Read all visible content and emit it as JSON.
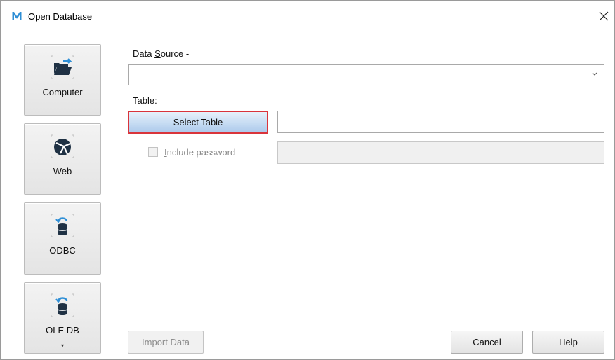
{
  "window": {
    "title": "Open Database",
    "logo_letter": "M",
    "logo_color": "#2f8fd6"
  },
  "sidebar": {
    "items": [
      {
        "label": "Computer",
        "icon": "folder-open-icon"
      },
      {
        "label": "Web",
        "icon": "globe-icon"
      },
      {
        "label": "ODBC",
        "icon": "database-refresh-icon"
      },
      {
        "label": "OLE DB",
        "icon": "database-refresh-icon",
        "dropdown": "▾"
      }
    ]
  },
  "form": {
    "data_source": {
      "label_prefix": "Data ",
      "label_accel": "S",
      "label_suffix": "ource -",
      "value": ""
    },
    "table": {
      "label": "Table:",
      "select_button_label": "Select Table",
      "value": ""
    },
    "include_password": {
      "label_accel": "I",
      "label_rest": "nclude password",
      "checked": false,
      "enabled": false
    }
  },
  "buttons": {
    "import": "Import Data",
    "cancel": "Cancel",
    "help": "Help"
  },
  "colors": {
    "accent": "#2f8fd6",
    "selected_border": "#d9343b",
    "icon_dark": "#1f3144"
  }
}
